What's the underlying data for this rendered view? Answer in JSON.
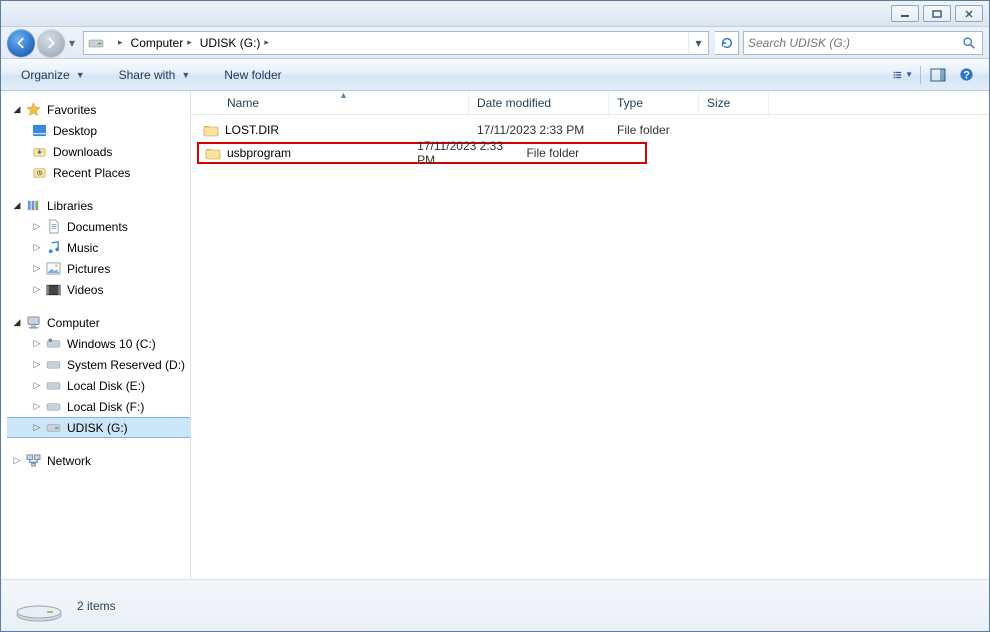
{
  "breadcrumb": {
    "root_caret": "▸",
    "items": [
      {
        "label": "Computer"
      },
      {
        "label": "UDISK (G:)"
      }
    ]
  },
  "search": {
    "placeholder": "Search UDISK (G:)"
  },
  "toolbar": {
    "organize": "Organize",
    "share": "Share with",
    "newfolder": "New folder"
  },
  "columns": {
    "name": "Name",
    "date": "Date modified",
    "type": "Type",
    "size": "Size"
  },
  "rows": [
    {
      "name": "LOST.DIR",
      "date": "17/11/2023 2:33 PM",
      "type": "File folder",
      "size": "",
      "highlight": false
    },
    {
      "name": "usbprogram",
      "date": "17/11/2023 2:33 PM",
      "type": "File folder",
      "size": "",
      "highlight": true
    }
  ],
  "sidebar": {
    "favorites": {
      "label": "Favorites",
      "items": [
        {
          "label": "Desktop"
        },
        {
          "label": "Downloads"
        },
        {
          "label": "Recent Places"
        }
      ]
    },
    "libraries": {
      "label": "Libraries",
      "items": [
        {
          "label": "Documents"
        },
        {
          "label": "Music"
        },
        {
          "label": "Pictures"
        },
        {
          "label": "Videos"
        }
      ]
    },
    "computer": {
      "label": "Computer",
      "items": [
        {
          "label": "Windows 10 (C:)"
        },
        {
          "label": "System Reserved (D:)"
        },
        {
          "label": "Local Disk (E:)"
        },
        {
          "label": "Local Disk (F:)"
        },
        {
          "label": "UDISK (G:)",
          "selected": true
        }
      ]
    },
    "network": {
      "label": "Network"
    }
  },
  "status": {
    "count": "2 items"
  }
}
